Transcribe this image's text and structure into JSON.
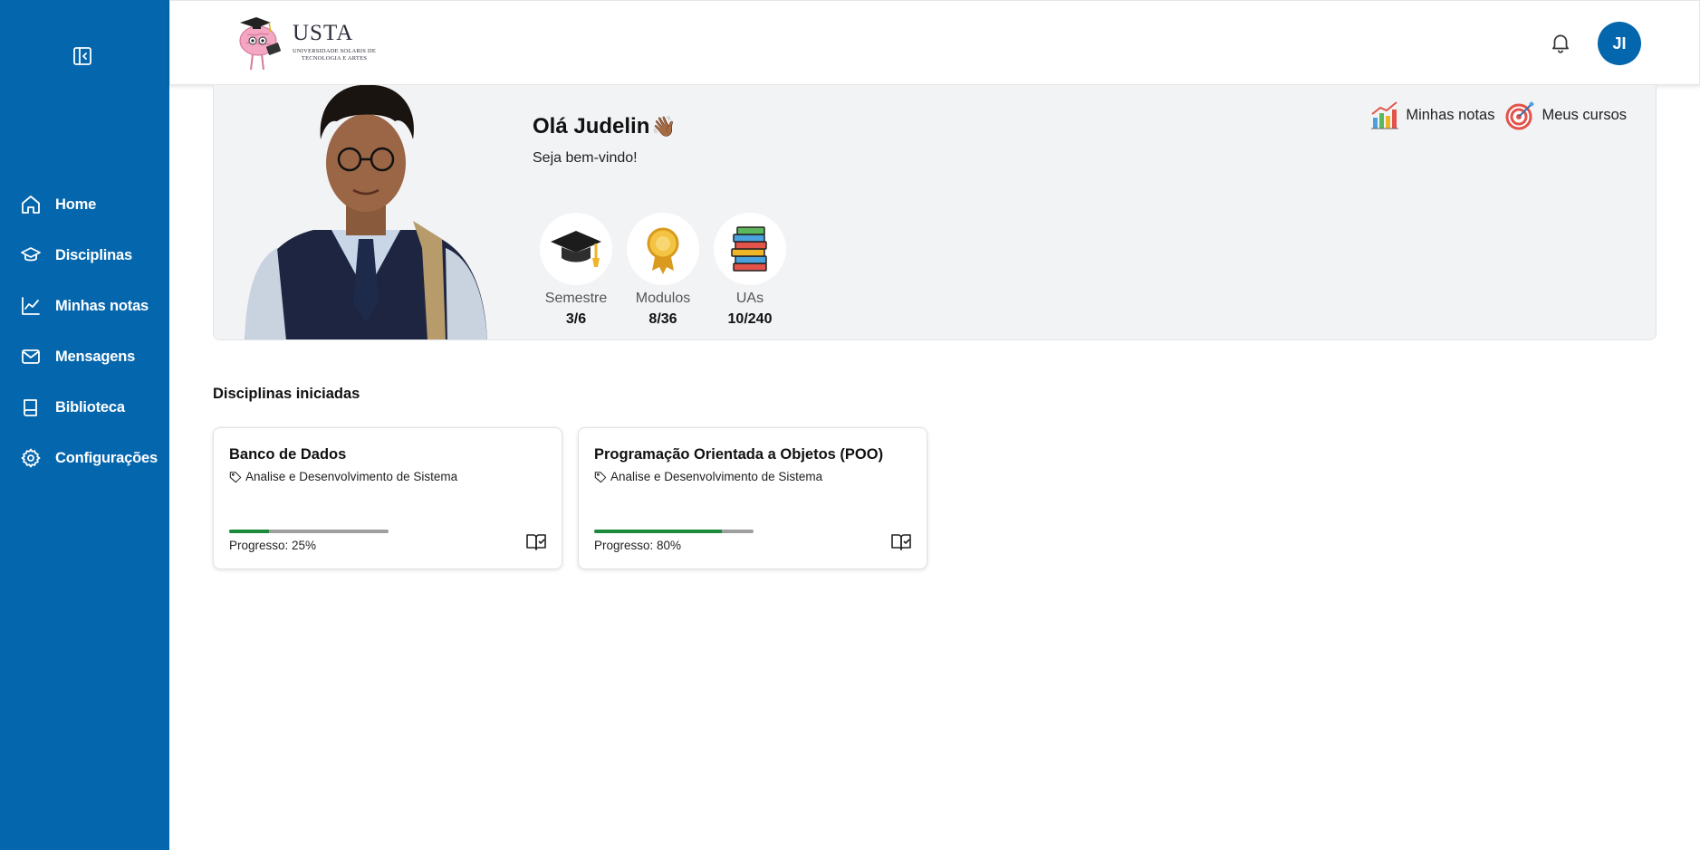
{
  "sidebar": {
    "collapse_icon": "sidebar-collapse-icon",
    "items": [
      {
        "label": "Home",
        "icon": "home-icon"
      },
      {
        "label": "Disciplinas",
        "icon": "graduation-cap-icon"
      },
      {
        "label": "Minhas notas",
        "icon": "line-chart-icon"
      },
      {
        "label": "Mensagens",
        "icon": "mail-icon"
      },
      {
        "label": "Biblioteca",
        "icon": "book-icon"
      },
      {
        "label": "Configurações",
        "icon": "gear-icon"
      }
    ]
  },
  "header": {
    "logo": {
      "title": "USTA",
      "subtitle": "Universidade Solaris de Tecnologia e Artes"
    },
    "notification_icon": "bell-icon",
    "avatar_initials": "JI"
  },
  "welcome": {
    "greeting": "Olá Judelin",
    "wave_emoji": "👋🏾",
    "subtitle": "Seja bem-vindo!",
    "stats": [
      {
        "label": "Semestre",
        "value": "3/6",
        "icon": "graduation-cap-icon"
      },
      {
        "label": "Modulos",
        "value": "8/36",
        "icon": "medal-icon"
      },
      {
        "label": "UAs",
        "value": "10/240",
        "icon": "books-icon"
      }
    ],
    "quick_links": [
      {
        "label": "Minhas notas",
        "icon": "bar-chart-icon"
      },
      {
        "label": "Meus cursos",
        "icon": "target-icon"
      }
    ]
  },
  "disciplines": {
    "title": "Disciplinas iniciadas",
    "cards": [
      {
        "title": "Banco de Dados",
        "tag": "Analise e Desenvolvimento de Sistema",
        "progress": 25,
        "progress_label": "Progresso: 25%"
      },
      {
        "title": "Programação Orientada a Objetos (POO)",
        "tag": "Analise e Desenvolvimento de Sistema",
        "progress": 80,
        "progress_label": "Progresso: 80%"
      }
    ]
  },
  "colors": {
    "sidebar": "#0466ad",
    "progress": "#1b8b3b",
    "panel": "#f2f3f5"
  }
}
